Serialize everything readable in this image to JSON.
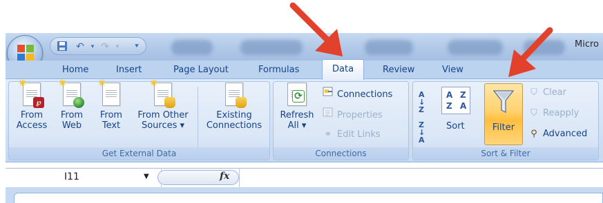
{
  "window": {
    "title": "Micro"
  },
  "tabs": [
    {
      "label": "Home"
    },
    {
      "label": "Insert"
    },
    {
      "label": "Page Layout"
    },
    {
      "label": "Formulas"
    },
    {
      "label": "Data",
      "active": true
    },
    {
      "label": "Review"
    },
    {
      "label": "View"
    }
  ],
  "ribbon": {
    "get_external_data": {
      "label": "Get External Data",
      "buttons": [
        {
          "line1": "From",
          "line2": "Access",
          "icon": "access-icon"
        },
        {
          "line1": "From",
          "line2": "Web",
          "icon": "web-icon"
        },
        {
          "line1": "From",
          "line2": "Text",
          "icon": "text-icon"
        },
        {
          "line1": "From Other",
          "line2": "Sources ▾",
          "icon": "database-icon"
        },
        {
          "line1": "Existing",
          "line2": "Connections",
          "icon": "existing-connections-icon"
        }
      ]
    },
    "connections": {
      "label": "Connections",
      "refresh": {
        "line1": "Refresh",
        "line2": "All ▾"
      },
      "items": [
        {
          "label": "Connections",
          "disabled": false
        },
        {
          "label": "Properties",
          "disabled": true
        },
        {
          "label": "Edit Links",
          "disabled": true
        }
      ]
    },
    "sort_filter": {
      "label": "Sort & Filter",
      "sort_label": "Sort",
      "filter_label": "Filter",
      "sort_az_glyph": "A↓Z",
      "sort_za_glyph": "Z↓A",
      "az_grid": [
        "A",
        "Z",
        "Z",
        "A"
      ],
      "items": [
        {
          "label": "Clear",
          "disabled": true
        },
        {
          "label": "Reapply",
          "disabled": true
        },
        {
          "label": "Advanced",
          "disabled": false
        }
      ]
    }
  },
  "formula_bar": {
    "name_box": "I11",
    "fx": "fx"
  },
  "colors": {
    "annotation_arrow": "#e2412b",
    "filter_active": "#ffcf66"
  }
}
